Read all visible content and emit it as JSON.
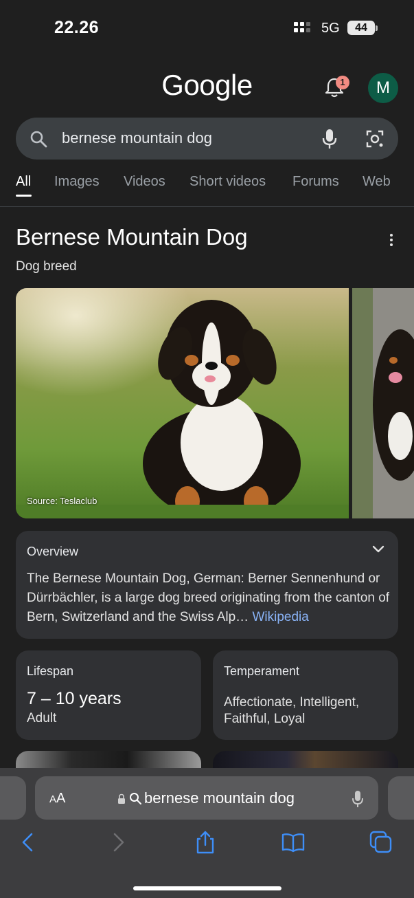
{
  "status_bar": {
    "time": "22.26",
    "network": "5G",
    "battery": "44"
  },
  "header": {
    "logo": "Google",
    "notification_count": "1",
    "avatar_letter": "M"
  },
  "search": {
    "query": "bernese mountain dog"
  },
  "tabs": [
    "All",
    "Images",
    "Videos",
    "Short videos",
    "Forums",
    "Web"
  ],
  "knowledge_panel": {
    "title": "Bernese Mountain Dog",
    "subtitle": "Dog breed",
    "image_source": "Source: Teslaclub",
    "overview": {
      "label": "Overview",
      "text": "The Bernese Mountain Dog, German: Berner Sennenhund or Dürrbächler, is a large dog breed originating from the canton of Bern, Switzerland and the Swiss Alp",
      "ellipsis": "…",
      "link": "Wikipedia"
    },
    "lifespan": {
      "label": "Lifespan",
      "value": "7 – 10 years",
      "sub": "Adult"
    },
    "temperament": {
      "label": "Temperament",
      "value": "Affectionate, Intelligent, Faithful, Loyal"
    }
  },
  "browser": {
    "text_size_label_big": "A",
    "text_size_label_small": "A",
    "url": "bernese mountain dog"
  },
  "colors": {
    "background": "#1f1f1f",
    "search_box": "#3c4043",
    "card": "#303134",
    "link": "#8ab4f8",
    "avatar": "#0d5c46",
    "badge": "#f28b82",
    "safari_bar": "#3d3d3f"
  },
  "icons": [
    "search-icon",
    "mic-icon",
    "lens-icon",
    "bell-icon",
    "kebab-menu-icon",
    "chevron-down-icon",
    "lock-icon",
    "back-icon",
    "forward-icon",
    "share-icon",
    "bookmarks-icon",
    "tabs-icon"
  ]
}
